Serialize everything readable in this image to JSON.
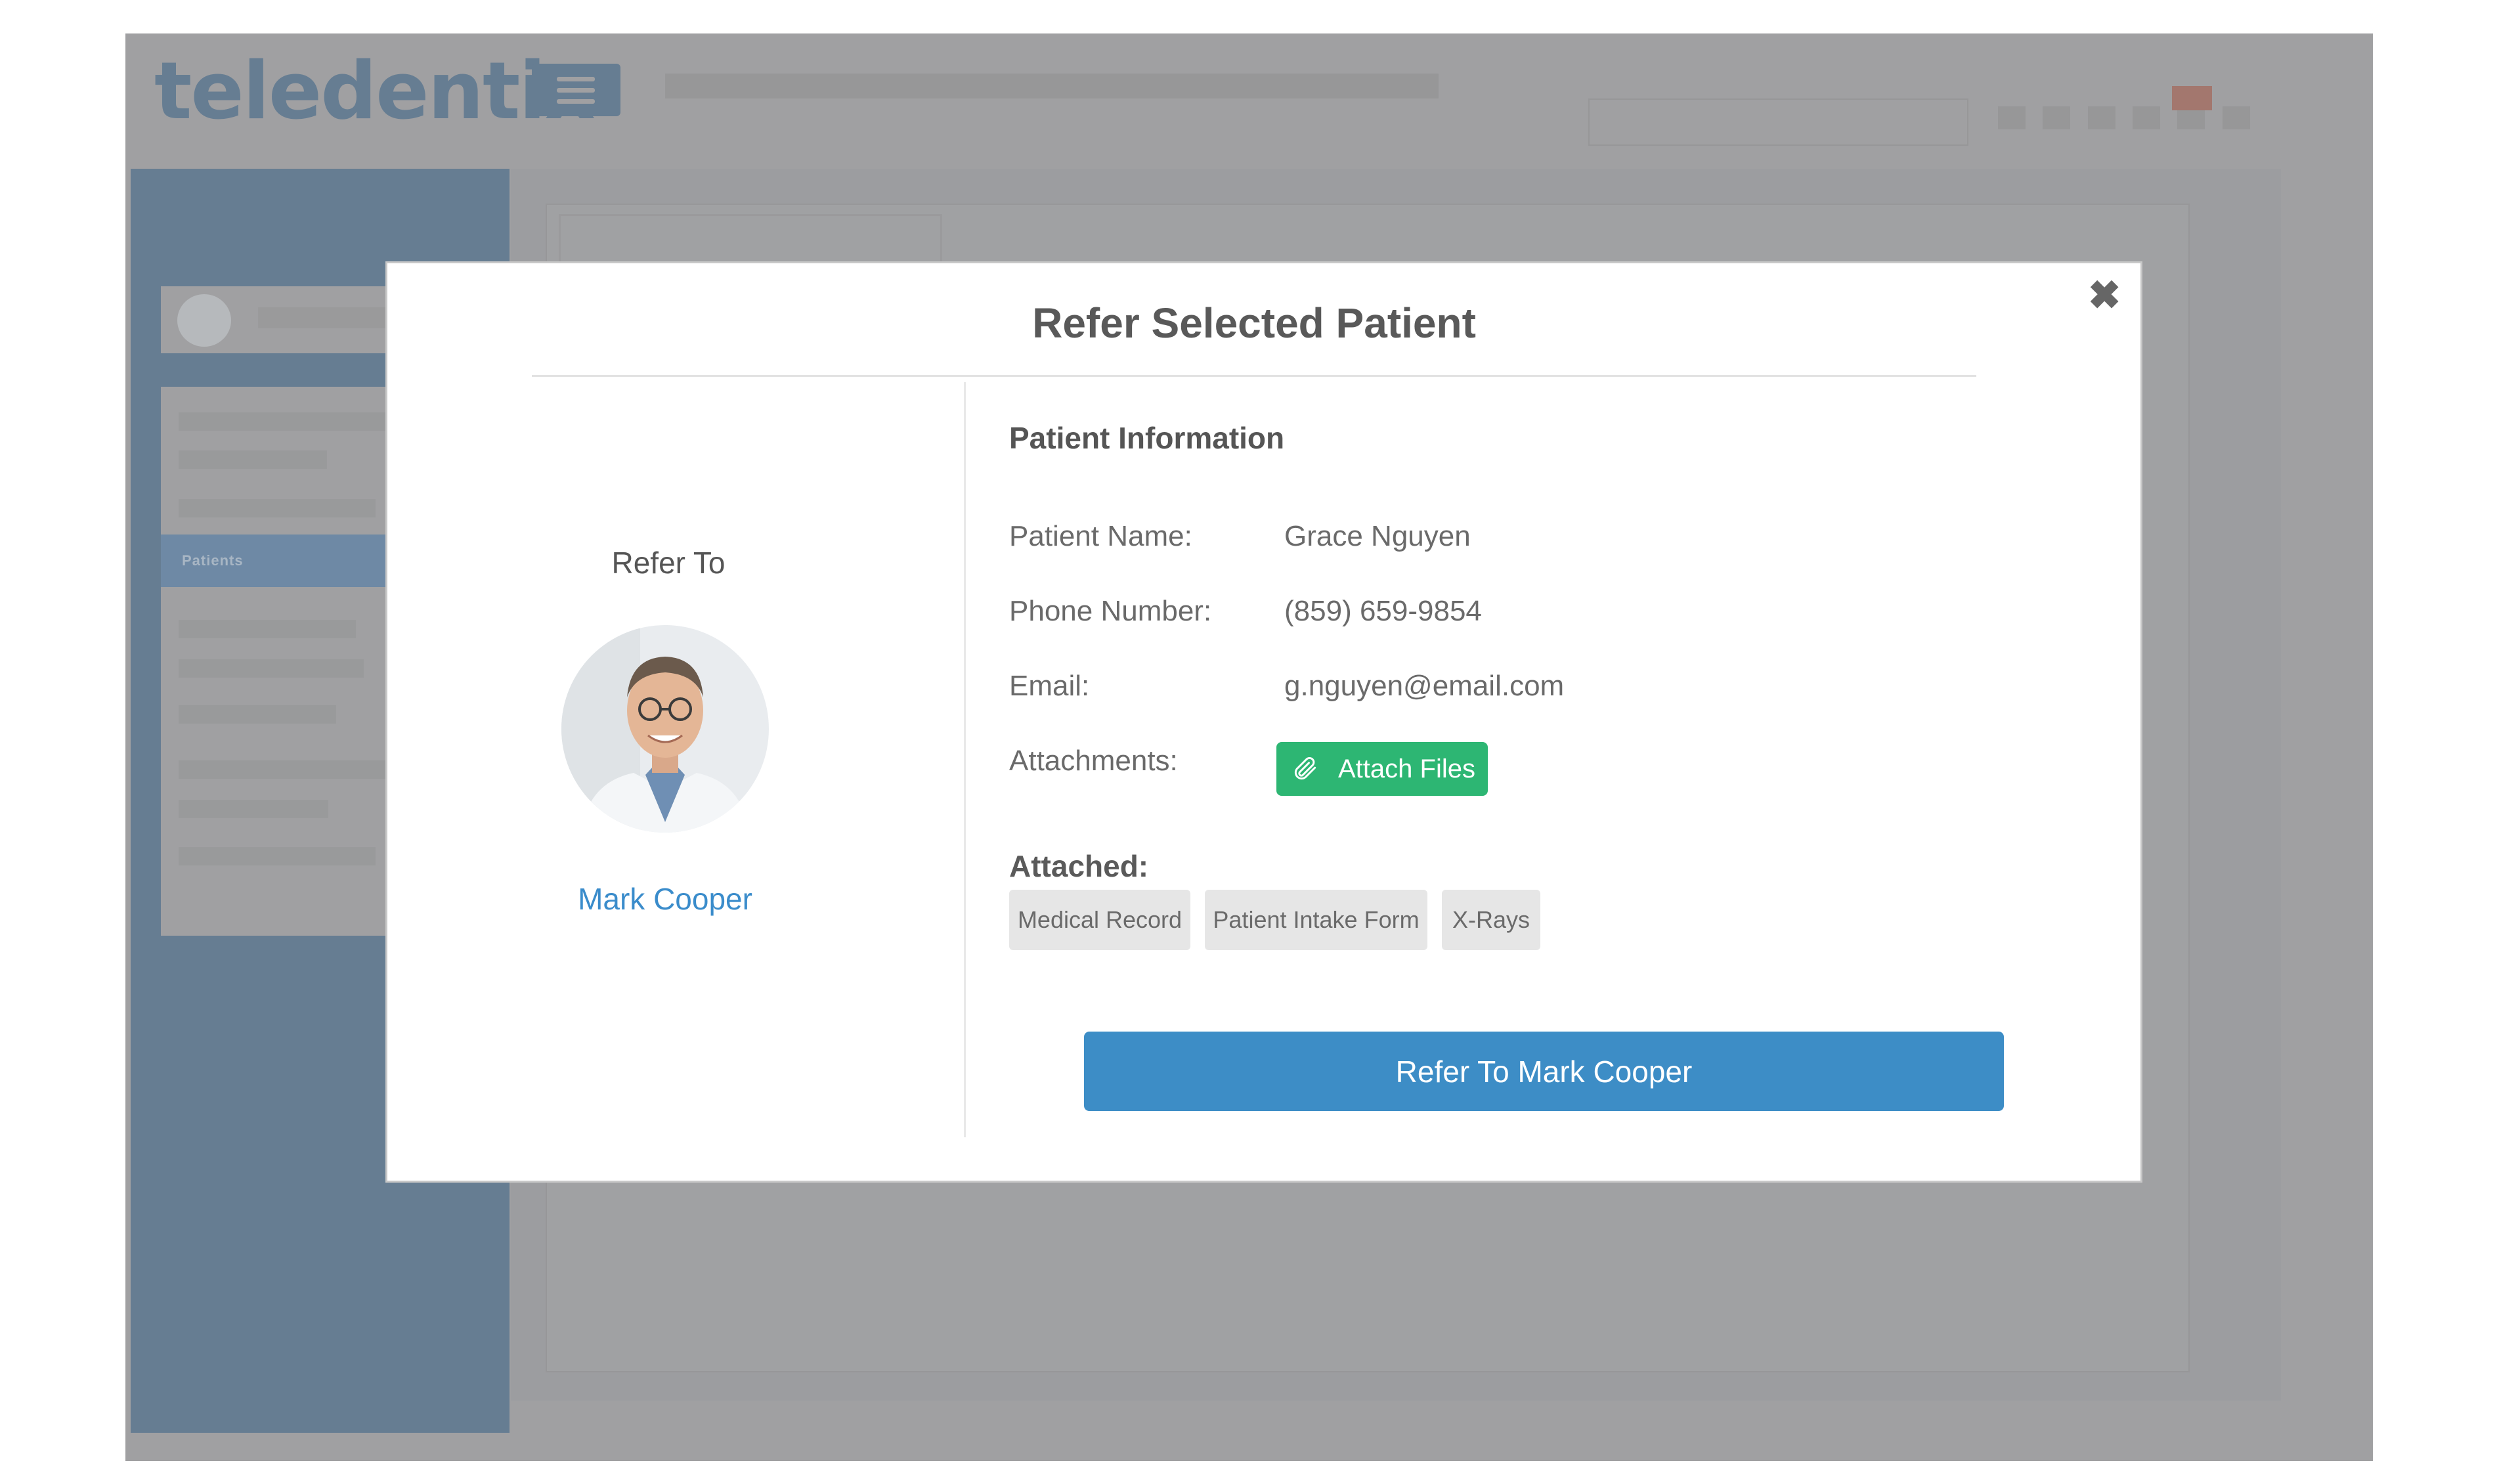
{
  "app": {
    "logo_text": "teledentix",
    "brand_color": "#667d92",
    "alert_color": "#a3776e"
  },
  "sidebar": {
    "active_item": "Patients"
  },
  "modal": {
    "title": "Refer Selected Patient",
    "close_icon": "close-icon",
    "refer_to_label": "Refer To",
    "doctor_name": "Mark Cooper",
    "patient_info_heading": "Patient Information",
    "fields": [
      {
        "label": "Patient Name:",
        "value": "Grace Nguyen"
      },
      {
        "label": "Phone Number:",
        "value": "(859) 659-9854"
      },
      {
        "label": "Email:",
        "value": "g.nguyen@email.com"
      },
      {
        "label": "Attachments:"
      }
    ],
    "attach_button": {
      "label": "Attach Files",
      "icon": "paperclip-icon",
      "color": "#2db673"
    },
    "attached_heading": "Attached:",
    "attached_files": [
      "Medical Record",
      "Patient Intake Form",
      "X-Rays"
    ],
    "refer_button": {
      "label": "Refer To Mark Cooper",
      "color": "#3d8dc6"
    }
  }
}
